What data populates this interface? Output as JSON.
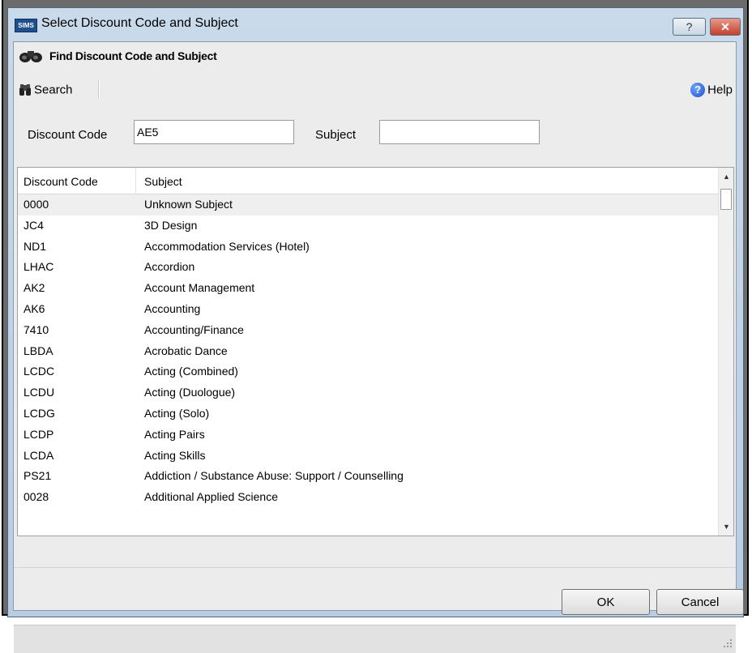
{
  "window": {
    "app_icon_text": "SIMS",
    "title": "Select Discount Code and Subject",
    "help_button": "?",
    "close_button": "✕"
  },
  "header": {
    "title": "Find Discount Code and Subject"
  },
  "toolbar": {
    "search_label": "Search",
    "help_label": "Help"
  },
  "filters": {
    "discount_code_label": "Discount Code",
    "discount_code_value": "AE5",
    "subject_label": "Subject",
    "subject_value": ""
  },
  "grid": {
    "columns": [
      "Discount Code",
      "Subject"
    ],
    "rows": [
      {
        "code": "0000",
        "subject": "Unknown Subject"
      },
      {
        "code": "JC4",
        "subject": "3D Design"
      },
      {
        "code": "ND1",
        "subject": "Accommodation Services (Hotel)"
      },
      {
        "code": "LHAC",
        "subject": "Accordion"
      },
      {
        "code": "AK2",
        "subject": "Account Management"
      },
      {
        "code": "AK6",
        "subject": "Accounting"
      },
      {
        "code": "7410",
        "subject": "Accounting/Finance"
      },
      {
        "code": "LBDA",
        "subject": "Acrobatic Dance"
      },
      {
        "code": "LCDC",
        "subject": "Acting (Combined)"
      },
      {
        "code": "LCDU",
        "subject": "Acting (Duologue)"
      },
      {
        "code": "LCDG",
        "subject": "Acting (Solo)"
      },
      {
        "code": "LCDP",
        "subject": "Acting Pairs"
      },
      {
        "code": "LCDA",
        "subject": "Acting Skills"
      },
      {
        "code": "PS21",
        "subject": "Addiction / Substance Abuse: Support / Counselling"
      },
      {
        "code": "0028",
        "subject": "Additional Applied Science"
      }
    ]
  },
  "buttons": {
    "ok": "OK",
    "cancel": "Cancel"
  }
}
